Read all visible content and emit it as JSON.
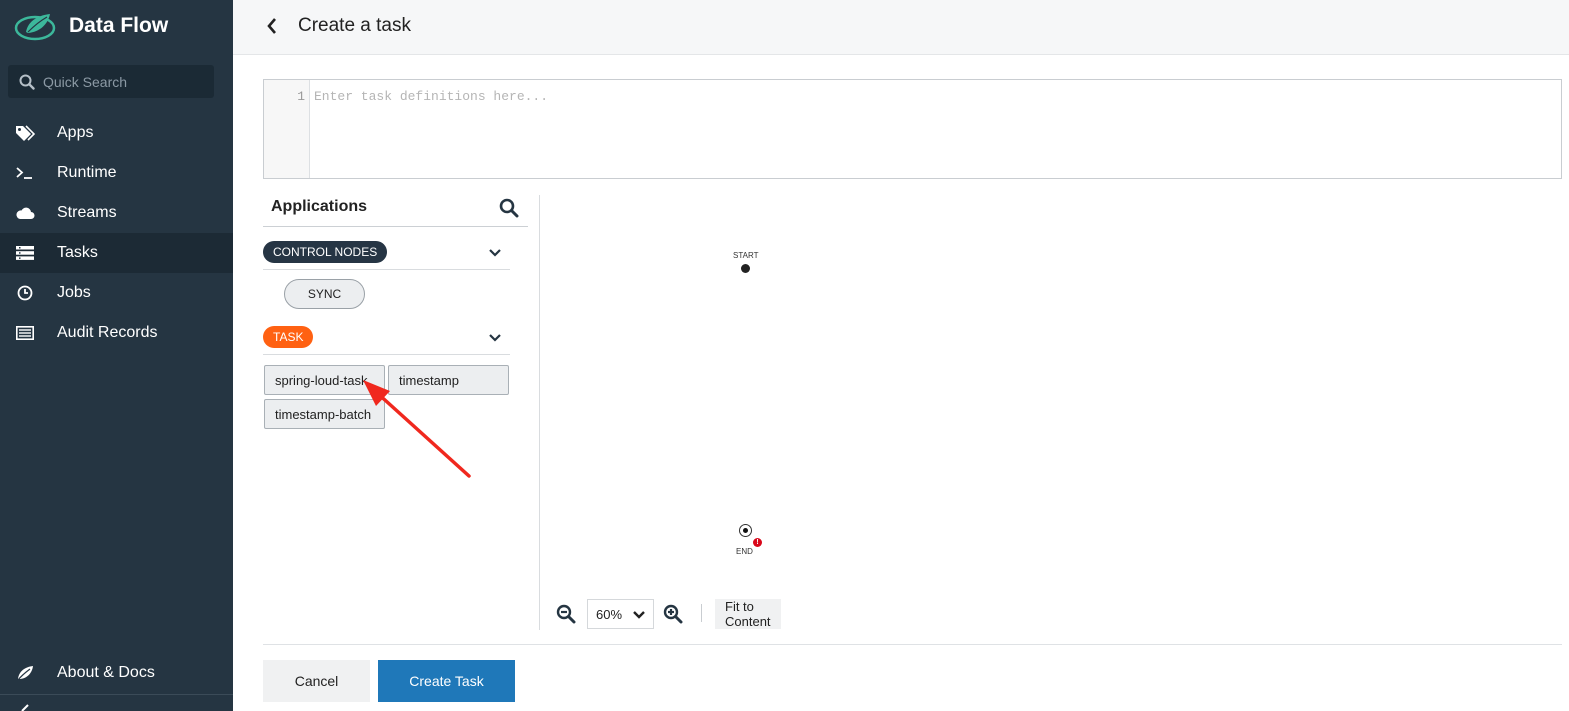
{
  "app": {
    "title": "Data Flow"
  },
  "search": {
    "placeholder": "Quick Search"
  },
  "sidebar": {
    "items": [
      {
        "label": "Apps",
        "icon": "tag-icon",
        "active": false
      },
      {
        "label": "Runtime",
        "icon": "terminal-icon",
        "active": false
      },
      {
        "label": "Streams",
        "icon": "cloud-icon",
        "active": false
      },
      {
        "label": "Tasks",
        "icon": "tasks-icon",
        "active": true
      },
      {
        "label": "Jobs",
        "icon": "clock-icon",
        "active": false
      },
      {
        "label": "Audit Records",
        "icon": "records-icon",
        "active": false
      }
    ],
    "about_label": "About & Docs"
  },
  "header": {
    "title": "Create a task"
  },
  "editor": {
    "line_number": "1",
    "placeholder": "Enter task definitions here..."
  },
  "palette": {
    "title": "Applications",
    "groups": [
      {
        "label": "CONTROL NODES",
        "color": "#263544",
        "items": [
          "SYNC"
        ]
      },
      {
        "label": "TASK",
        "color": "#ff6112",
        "items": [
          "spring-loud-task",
          "timestamp",
          "timestamp-batch"
        ]
      }
    ]
  },
  "canvas": {
    "start_label": "START",
    "end_label": "END",
    "end_error_mark": "!",
    "zoom_value": "60%",
    "fit_label": "Fit to Content"
  },
  "actions": {
    "cancel_label": "Cancel",
    "create_label": "Create Task"
  },
  "colors": {
    "sidebar": "#253542",
    "accent": "#1f78b9",
    "task": "#ff6112",
    "annotation": "#f0281e"
  }
}
